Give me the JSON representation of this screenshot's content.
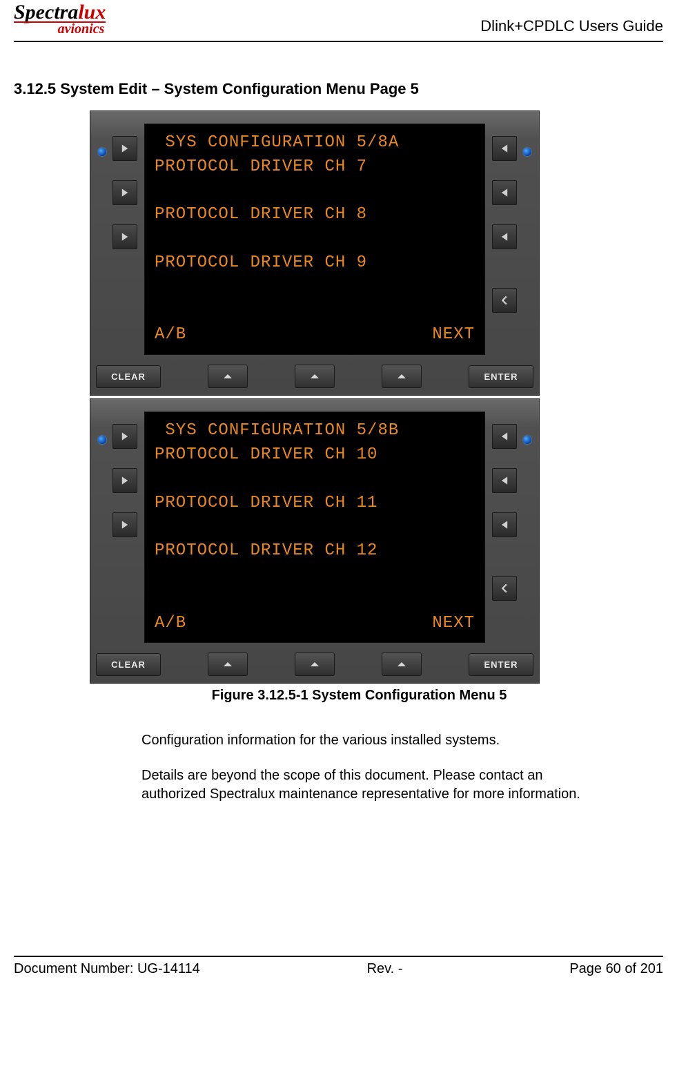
{
  "header": {
    "logo_text_black": "Spectra",
    "logo_text_red": "lux",
    "logo_sub": "avionics",
    "guide_title": "Dlink+CPDLC Users Guide"
  },
  "section": {
    "heading": "3.12.5 System Edit – System Configuration Menu Page 5"
  },
  "device_a": {
    "title": " SYS CONFIGURATION 5/8A",
    "line1": "PROTOCOL DRIVER CH 7",
    "line2": "PROTOCOL DRIVER CH 8",
    "line3": "PROTOCOL DRIVER CH 9",
    "bottom_left": "A/B",
    "bottom_right": "NEXT",
    "clear": "CLEAR",
    "enter": "ENTER"
  },
  "device_b": {
    "title": " SYS CONFIGURATION 5/8B",
    "line1": "PROTOCOL DRIVER CH 10",
    "line2": "PROTOCOL DRIVER CH 11",
    "line3": "PROTOCOL DRIVER CH 12",
    "bottom_left": "A/B",
    "bottom_right": "NEXT",
    "clear": "CLEAR",
    "enter": "ENTER"
  },
  "figure_caption": "Figure 3.12.5-1 System Configuration Menu 5",
  "body": {
    "p1": "Configuration information for the various installed systems.",
    "p2": "Details are beyond the scope of this document.  Please contact an authorized Spectralux maintenance representative for more information."
  },
  "footer": {
    "doc": "Document Number:  UG-14114",
    "rev": "Rev. -",
    "page": "Page 60 of 201"
  }
}
